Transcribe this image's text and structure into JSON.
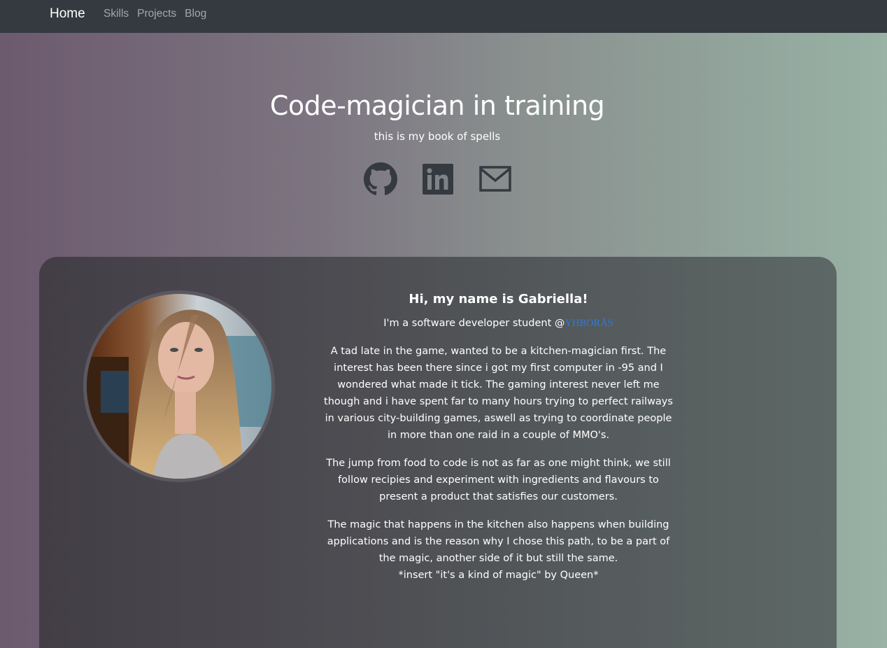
{
  "nav": {
    "brand": "Home",
    "links": [
      "Skills",
      "Projects",
      "Blog"
    ]
  },
  "hero": {
    "title": "Code-magician in training",
    "subtitle": "this is my book of spells",
    "social_icons": [
      "github-icon",
      "linkedin-icon",
      "mail-icon"
    ]
  },
  "about": {
    "heading": "Hi, my name is Gabriella!",
    "intro_prefix": "I'm a software developer student @",
    "intro_link": "YHBORÅS",
    "paragraphs": [
      "A tad late in the game, wanted to be a kitchen-magician first. The interest has been there since i got my first computer in -95 and I wondered what made it tick. The gaming interest never left me though and i have spent far to many hours trying to perfect railways in various city-building games, aswell as trying to coordinate people in more than one raid in a couple of MMO's.",
      "The jump from food to code is not as far as one might think, we still follow recipies and experiment with ingredients and flavours to present a product that satisfies our customers."
    ],
    "closing_line1": "The magic that happens in the kitchen also happens when building applications and is the reason why I chose this path, to be a part of the magic, another side of it but still the same.",
    "closing_line2": "*insert \"it's a kind of magic\" by Queen*"
  },
  "colors": {
    "navbar": "#343a40",
    "link": "#2a7ae2",
    "icon": "#343a40"
  }
}
